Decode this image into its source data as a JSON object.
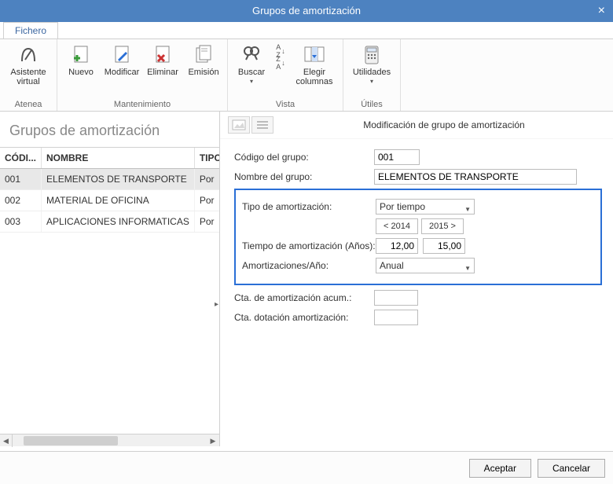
{
  "window": {
    "title": "Grupos de amortización"
  },
  "tabs": {
    "file": "Fichero"
  },
  "ribbon": {
    "atenea": {
      "assistant": "Asistente\nvirtual",
      "group": "Atenea"
    },
    "maint": {
      "new": "Nuevo",
      "modify": "Modificar",
      "delete": "Eliminar",
      "emit": "Emisión",
      "group": "Mantenimiento"
    },
    "view": {
      "search": "Buscar",
      "cols": "Elegir\ncolumnas",
      "group": "Vista"
    },
    "utils": {
      "utilities": "Utilidades",
      "group": "Útiles"
    }
  },
  "left": {
    "title": "Grupos de amortización",
    "cols": {
      "code": "CÓDI...",
      "name": "NOMBRE",
      "type": "TIPO"
    },
    "rows": [
      {
        "code": "001",
        "name": "ELEMENTOS DE TRANSPORTE",
        "type": "Por"
      },
      {
        "code": "002",
        "name": "MATERIAL DE OFICINA",
        "type": "Por"
      },
      {
        "code": "003",
        "name": "APLICACIONES INFORMATICAS",
        "type": "Por"
      }
    ]
  },
  "panel": {
    "title": "Modificación de grupo de amortización",
    "labels": {
      "code": "Código del grupo:",
      "name": "Nombre del grupo:",
      "type": "Tipo de amortización:",
      "years": "Tiempo de amortización (Años):",
      "perYear": "Amortizaciones/Año:",
      "ctaAcum": "Cta. de amortización acum.:",
      "ctaDot": "Cta. dotación amortización:"
    },
    "values": {
      "code": "001",
      "name": "ELEMENTOS DE TRANSPORTE",
      "type": "Por tiempo",
      "yearPrev": "< 2014",
      "yearNext": "2015 >",
      "yearsA": "12,00",
      "yearsB": "15,00",
      "perYear": "Anual",
      "ctaAcum": "",
      "ctaDot": ""
    }
  },
  "buttons": {
    "accept": "Aceptar",
    "cancel": "Cancelar"
  }
}
